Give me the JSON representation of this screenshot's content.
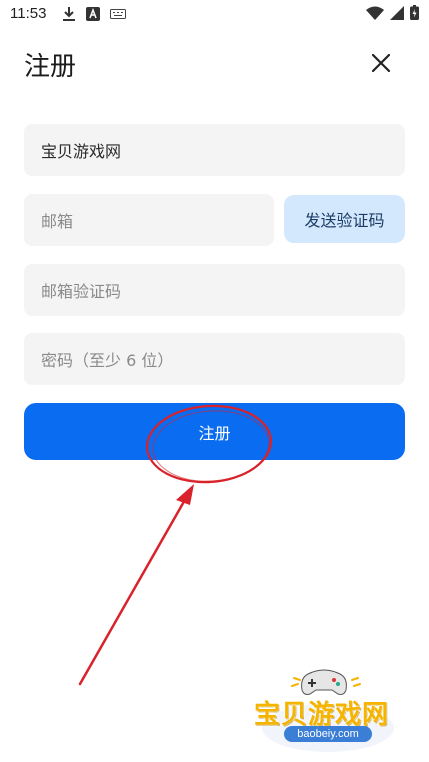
{
  "status_bar": {
    "time": "11:53",
    "left_icons": [
      "download-icon",
      "app-a-icon",
      "keyboard-icon"
    ],
    "right_icons": [
      "wifi-icon",
      "signal-icon",
      "battery-charging-icon"
    ]
  },
  "header": {
    "title": "注册",
    "close_icon": "close-icon"
  },
  "form": {
    "name_value": "宝贝游戏网",
    "email_placeholder": "邮箱",
    "send_code_label": "发送验证码",
    "code_placeholder": "邮箱验证码",
    "password_placeholder": "密码（至少 6 位）",
    "submit_label": "注册"
  },
  "watermark": {
    "text": "宝贝游戏网",
    "domain": "baobeiy.com"
  },
  "colors": {
    "primary": "#0a6cf1",
    "secondary_button": "#d4e8fd",
    "field_bg": "#f4f4f4",
    "annotation": "#d9222a"
  }
}
